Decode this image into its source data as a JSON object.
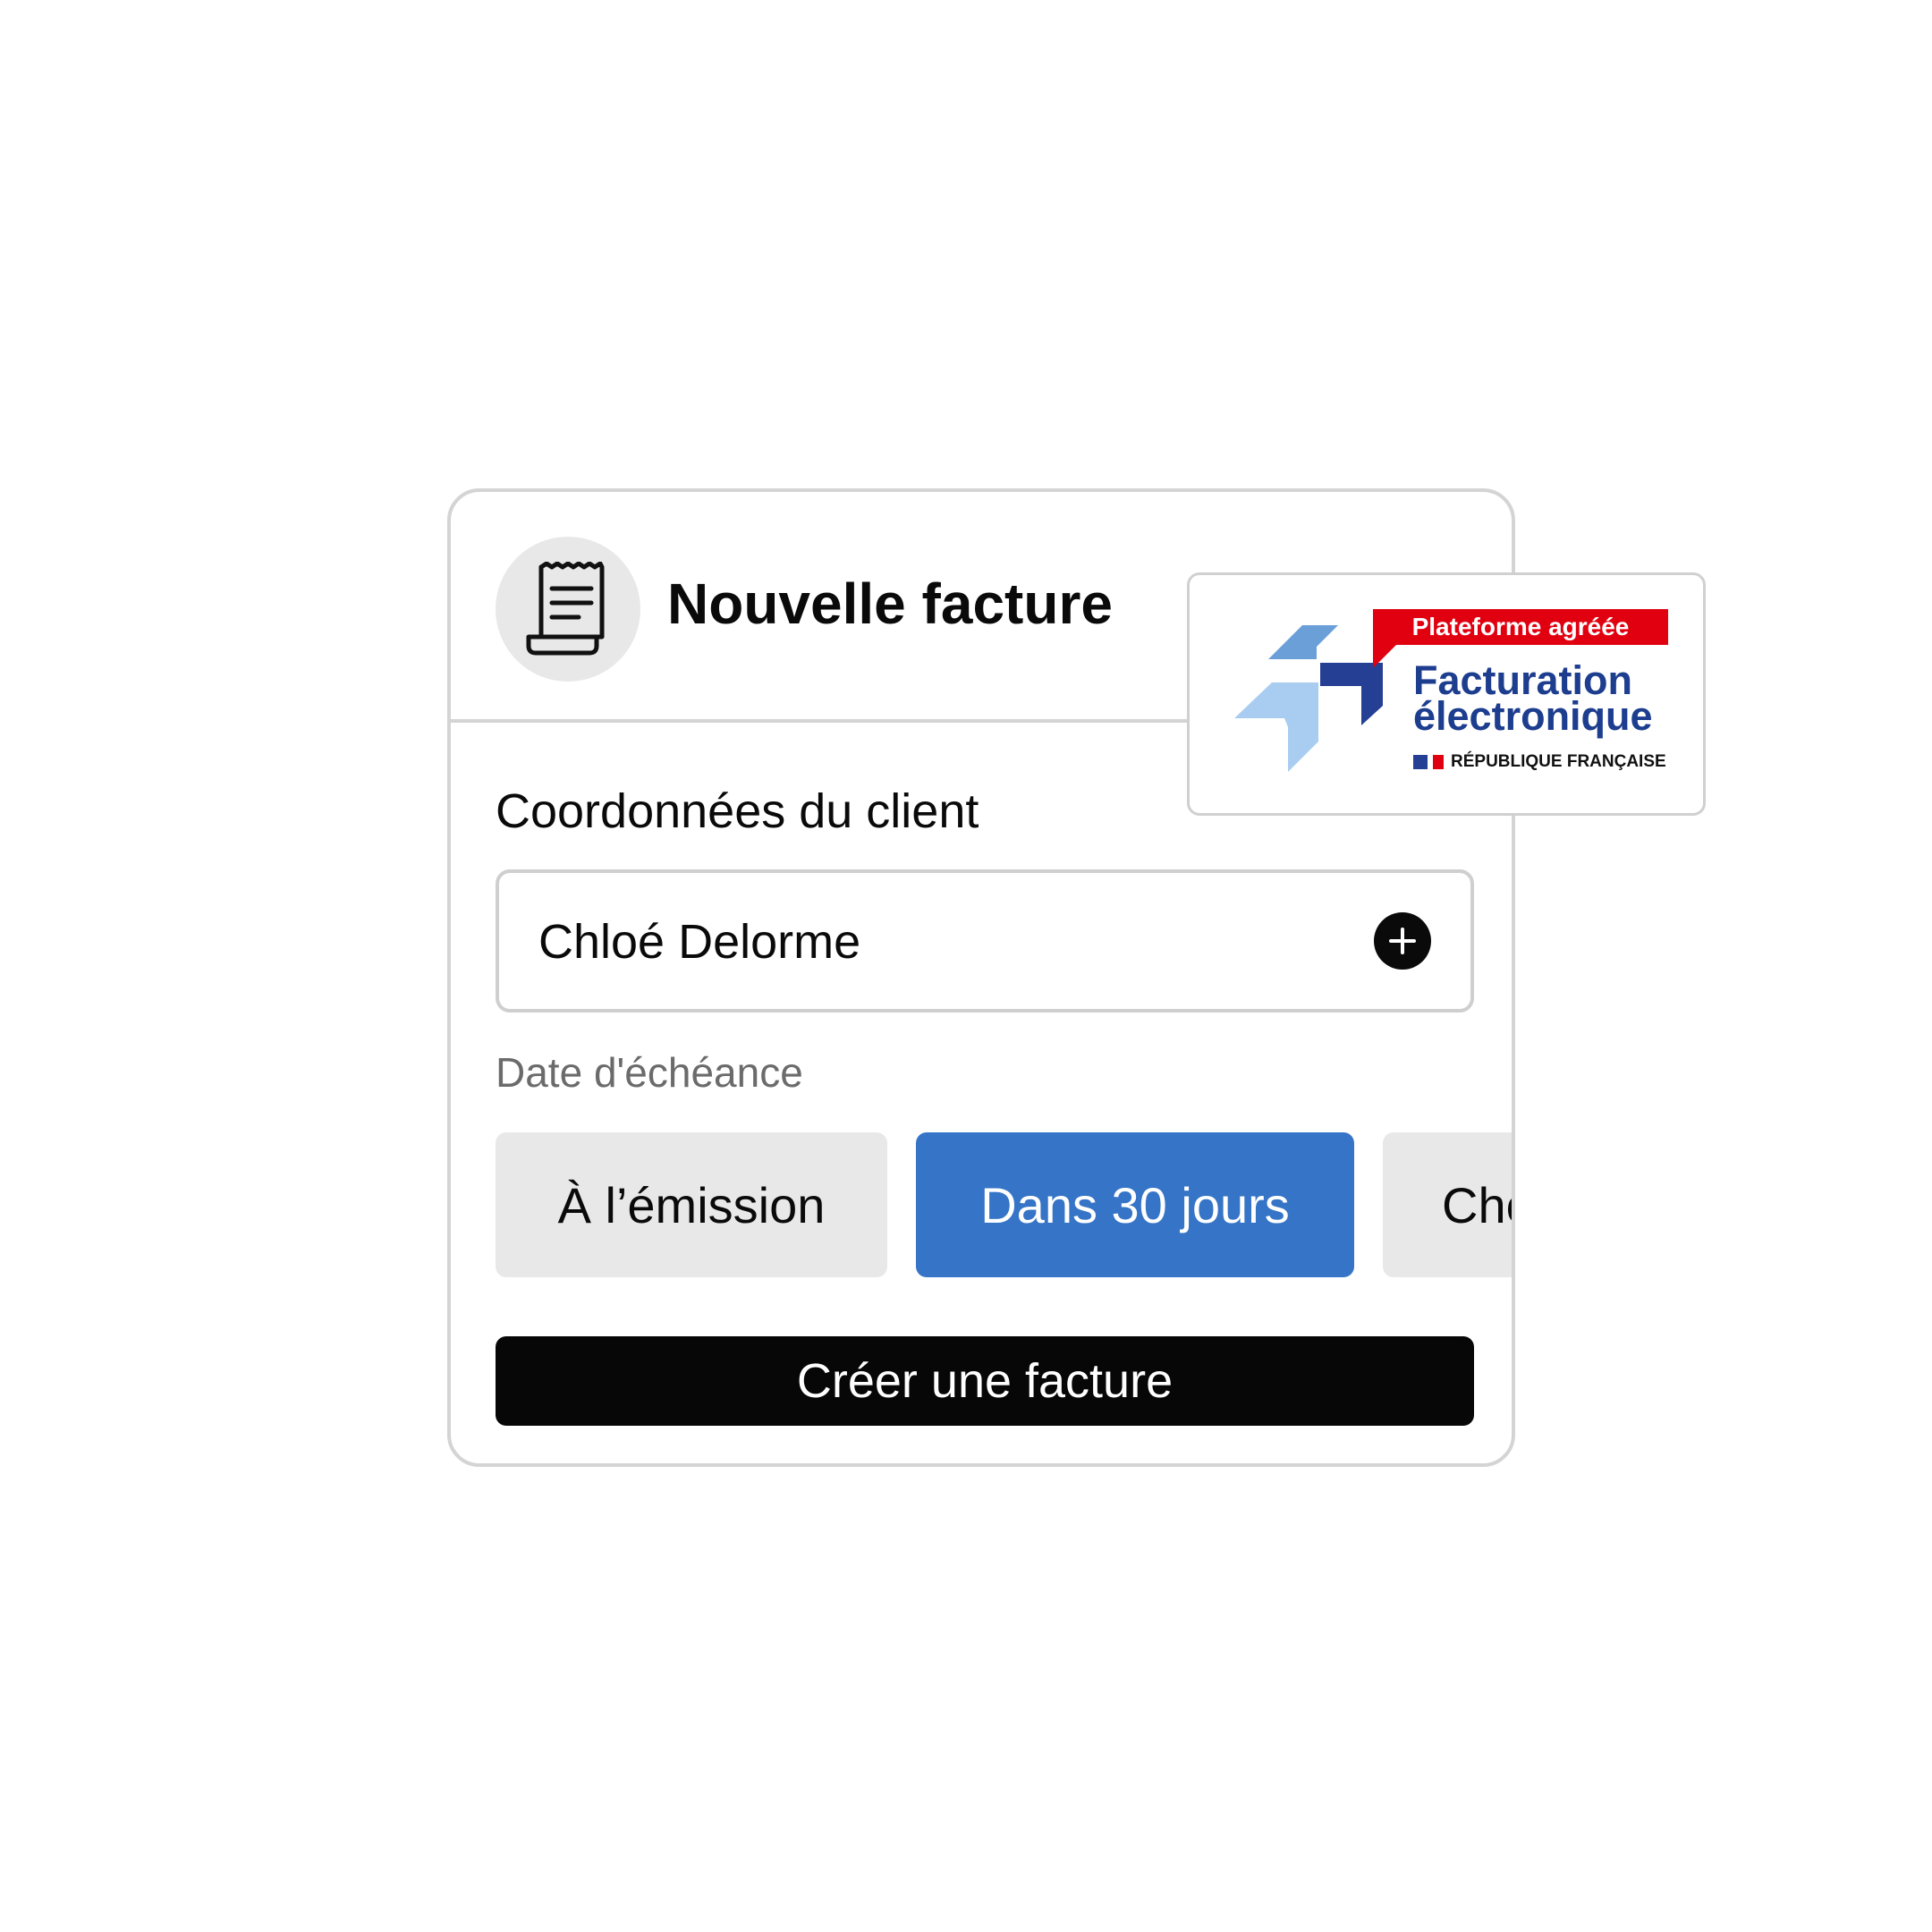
{
  "card": {
    "title": "Nouvelle facture",
    "section_label": "Coordonnées du client",
    "client_name": "Chloé Delorme",
    "due_label": "Date d'échéance",
    "due_options": [
      "À l’émission",
      "Dans 30 jours",
      "Cho"
    ],
    "selected_option": "Dans 30 jours",
    "create_button": "Créer une facture"
  },
  "badge": {
    "ribbon": "Plateforme agréée",
    "title_line1": "Facturation",
    "title_line2": "électronique",
    "subtitle": "RÉPUBLIQUE FRANÇAISE"
  },
  "colors": {
    "accent": "#3574c6",
    "primary_button": "#070707",
    "chip_grey": "#e8e8e8",
    "badge_red": "#e1000f",
    "badge_blue": "#1d3d8f"
  },
  "icons": {
    "header": "receipt-icon",
    "add": "plus-icon"
  }
}
